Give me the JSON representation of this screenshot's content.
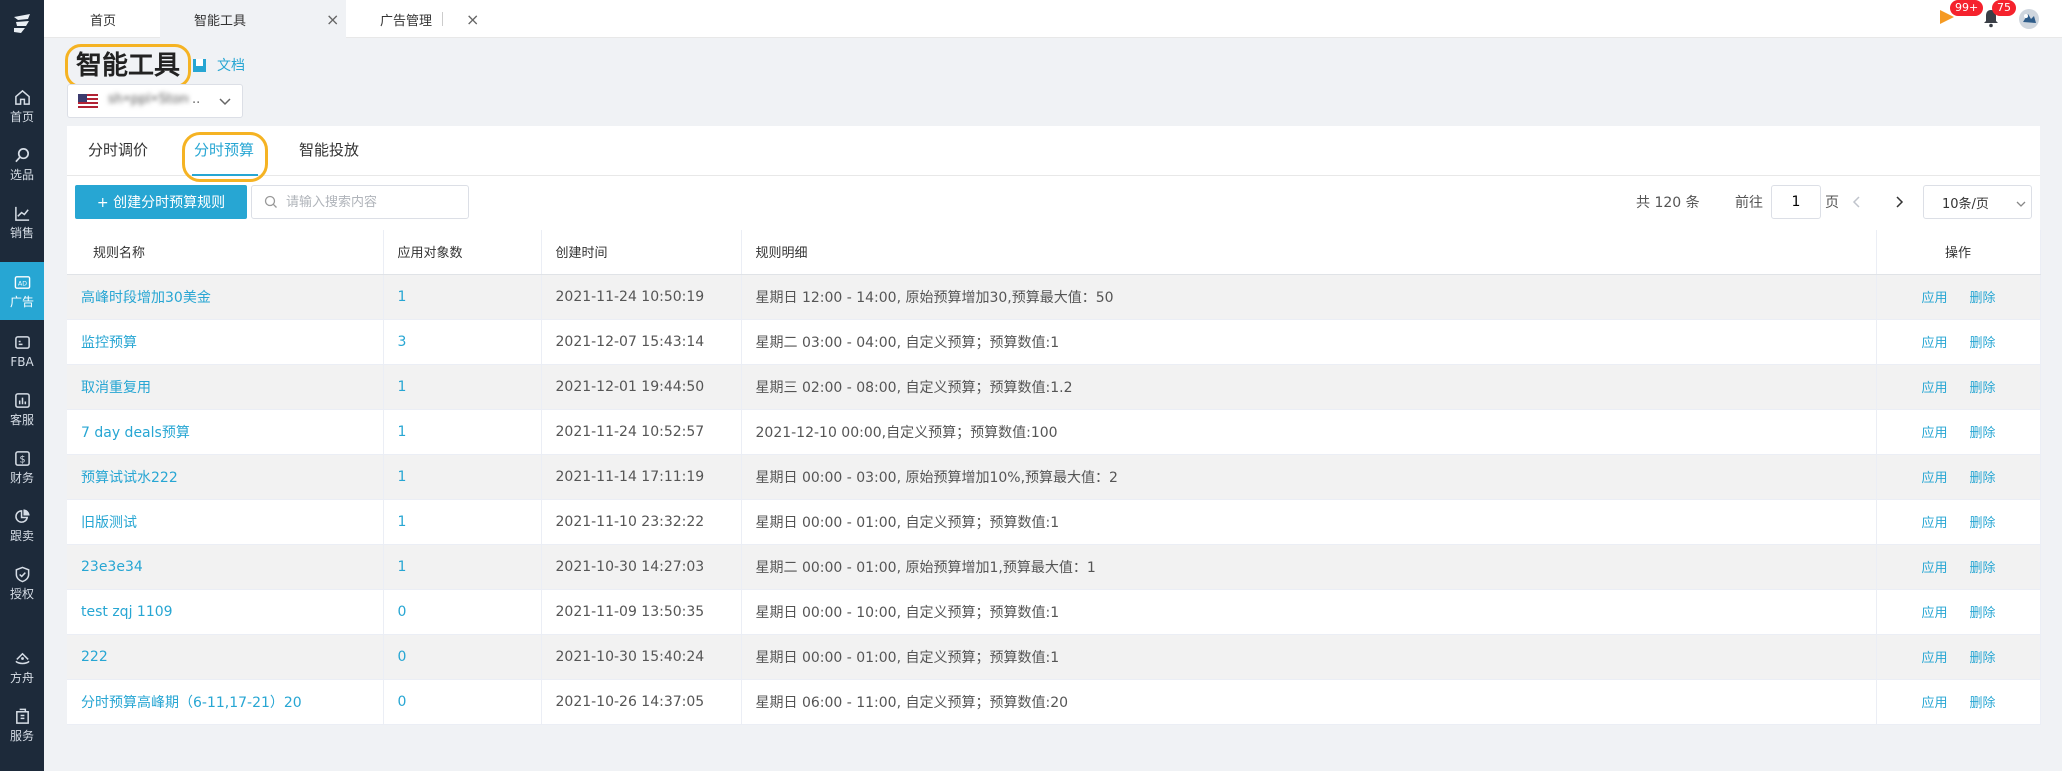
{
  "sidebar": {
    "items": [
      {
        "label": "首页",
        "icon": "home-icon"
      },
      {
        "label": "选品",
        "icon": "search-icon"
      },
      {
        "label": "销售",
        "icon": "trend-chart-icon"
      },
      {
        "label": "广告",
        "icon": "ad-icon",
        "active": true
      },
      {
        "label": "FBA",
        "icon": "warehouse-icon"
      },
      {
        "label": "客服",
        "icon": "bar-chart-icon"
      },
      {
        "label": "财务",
        "icon": "dollar-icon"
      },
      {
        "label": "跟卖",
        "icon": "pie-chart-icon"
      },
      {
        "label": "授权",
        "icon": "shield-icon"
      },
      {
        "label": "方舟",
        "icon": "ark-icon"
      },
      {
        "label": "服务",
        "icon": "building-icon"
      }
    ]
  },
  "topbar": {
    "tabs": [
      {
        "label": "首页"
      },
      {
        "label": "智能工具",
        "active": true
      },
      {
        "label": "广告管理"
      }
    ],
    "close_glyph": "×",
    "notify_badge": "99+",
    "bell_badge": "75"
  },
  "header": {
    "title": "智能工具",
    "doc_label": "文档",
    "store_name": "sh•ppl•Store",
    "store_ellipsis": ".."
  },
  "subtabs": [
    {
      "label": "分时调价"
    },
    {
      "label": "分时预算",
      "active": true
    },
    {
      "label": "智能投放"
    }
  ],
  "toolbar": {
    "create_label": "+ 创建分时预算规则",
    "search_placeholder": "请输入搜索内容",
    "total_label": "共 120 条",
    "goto_label": "前往",
    "page_value": "1",
    "page_suffix": "页",
    "page_size": "10条/页"
  },
  "table": {
    "columns": [
      "规则名称",
      "应用对象数",
      "创建时间",
      "规则明细",
      "操作"
    ],
    "apply_label": "应用",
    "delete_label": "删除",
    "rows": [
      {
        "name": "高峰时段增加30美金",
        "count": "1",
        "created": "2021-11-24 10:50:19",
        "detail": "星期日 12:00 - 14:00, 原始预算增加30,预算最大值：50"
      },
      {
        "name": "监控预算",
        "count": "3",
        "created": "2021-12-07 15:43:14",
        "detail": "星期二 03:00 - 04:00, 自定义预算；预算数值:1"
      },
      {
        "name": "取消重复用",
        "count": "1",
        "created": "2021-12-01 19:44:50",
        "detail": "星期三 02:00 - 08:00, 自定义预算；预算数值:1.2"
      },
      {
        "name": "7 day deals预算",
        "count": "1",
        "created": "2021-11-24 10:52:57",
        "detail": "2021-12-10 00:00,自定义预算；预算数值:100"
      },
      {
        "name": "预算试试水222",
        "count": "1",
        "created": "2021-11-14 17:11:19",
        "detail": "星期日 00:00 - 03:00, 原始预算增加10%,预算最大值：2"
      },
      {
        "name": "旧版测试",
        "count": "1",
        "created": "2021-11-10 23:32:22",
        "detail": "星期日 00:00 - 01:00, 自定义预算；预算数值:1"
      },
      {
        "name": "23e3e34",
        "count": "1",
        "created": "2021-10-30 14:27:03",
        "detail": "星期二 00:00 - 01:00, 原始预算增加1,预算最大值：1"
      },
      {
        "name": "test zqj 1109",
        "count": "0",
        "created": "2021-11-09 13:50:35",
        "detail": "星期日 00:00 - 10:00, 自定义预算；预算数值:1"
      },
      {
        "name": "222",
        "count": "0",
        "created": "2021-10-30 15:40:24",
        "detail": "星期日 00:00 - 01:00, 自定义预算；预算数值:1"
      },
      {
        "name": "分时预算高峰期（6-11,17-21）20",
        "count": "0",
        "created": "2021-10-26 14:37:05",
        "detail": "星期日 06:00 - 11:00, 自定义预算；预算数值:20"
      }
    ]
  },
  "colors": {
    "accent": "#27a6d3",
    "sidebar_bg": "#1d2a3a",
    "highlight_ring": "#f5b323",
    "badge_red": "#f5222d"
  }
}
